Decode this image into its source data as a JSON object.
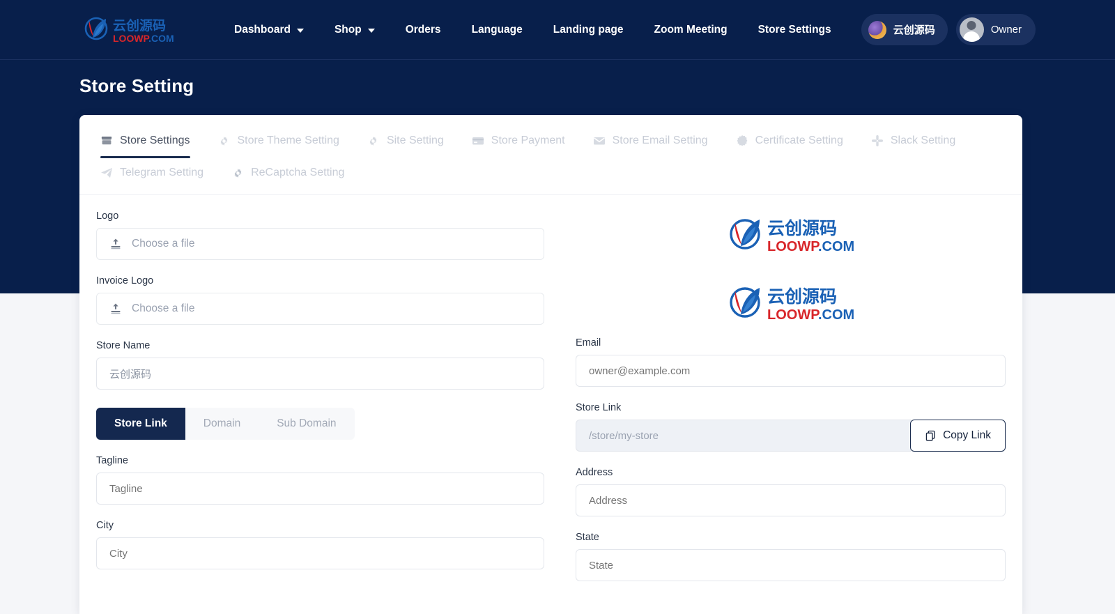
{
  "theme": {
    "navy": "#081f4b",
    "navy_dark": "#14284f",
    "pill_bg": "#1b3160",
    "page_bg": "#f5f6f9",
    "card_bg": "#ffffff",
    "muted_text": "#9aa2b1",
    "tab_inactive": "#c7ccd6",
    "logo_blue": "#1a61b5",
    "logo_red": "#d8262a"
  },
  "brand": {
    "name": "云创源码",
    "domain": "LOOWP.COM",
    "icon": "leaf-logo-icon"
  },
  "navbar": {
    "items": [
      {
        "label": "Dashboard",
        "has_dropdown": true
      },
      {
        "label": "Shop",
        "has_dropdown": true
      },
      {
        "label": "Orders",
        "has_dropdown": false
      },
      {
        "label": "Language",
        "has_dropdown": false
      },
      {
        "label": "Landing page",
        "has_dropdown": false
      },
      {
        "label": "Zoom Meeting",
        "has_dropdown": false
      },
      {
        "label": "Store Settings",
        "has_dropdown": false
      }
    ],
    "store_pill": {
      "label": "云创源码",
      "icon": "store-thumb-icon"
    },
    "owner_pill": {
      "label": "Owner",
      "icon": "avatar-icon"
    }
  },
  "header": {
    "title": "Store Setting"
  },
  "tabs": [
    {
      "label": "Store Settings",
      "icon": "store-icon",
      "active": true
    },
    {
      "label": "Store Theme Setting",
      "icon": "gear-icon",
      "active": false
    },
    {
      "label": "Site Setting",
      "icon": "gear-icon",
      "active": false
    },
    {
      "label": "Store Payment",
      "icon": "card-icon",
      "active": false
    },
    {
      "label": "Store Email Setting",
      "icon": "envelope-icon",
      "active": false
    },
    {
      "label": "Certificate Setting",
      "icon": "badge-icon",
      "active": false
    },
    {
      "label": "Slack Setting",
      "icon": "slack-icon",
      "active": false
    },
    {
      "label": "Telegram Setting",
      "icon": "telegram-icon",
      "active": false
    },
    {
      "label": "ReCaptcha Setting",
      "icon": "gear-icon",
      "active": false
    }
  ],
  "form": {
    "logo": {
      "label": "Logo",
      "file_placeholder": "Choose a file",
      "icon": "upload-icon"
    },
    "invoice_logo": {
      "label": "Invoice Logo",
      "file_placeholder": "Choose a file",
      "icon": "upload-icon"
    },
    "store_name": {
      "label": "Store Name",
      "value": "云创源码"
    },
    "link_type": {
      "options": [
        "Store Link",
        "Domain",
        "Sub Domain"
      ],
      "selected": "Store Link"
    },
    "tagline": {
      "label": "Tagline",
      "placeholder": "Tagline"
    },
    "city": {
      "label": "City",
      "placeholder": "City"
    },
    "email": {
      "label": "Email",
      "placeholder": "owner@example.com"
    },
    "store_link": {
      "label": "Store Link",
      "value": "/store/my-store",
      "copy_label": "Copy Link",
      "copy_icon": "copy-icon"
    },
    "address": {
      "label": "Address",
      "placeholder": "Address"
    },
    "state": {
      "label": "State",
      "placeholder": "State"
    }
  }
}
